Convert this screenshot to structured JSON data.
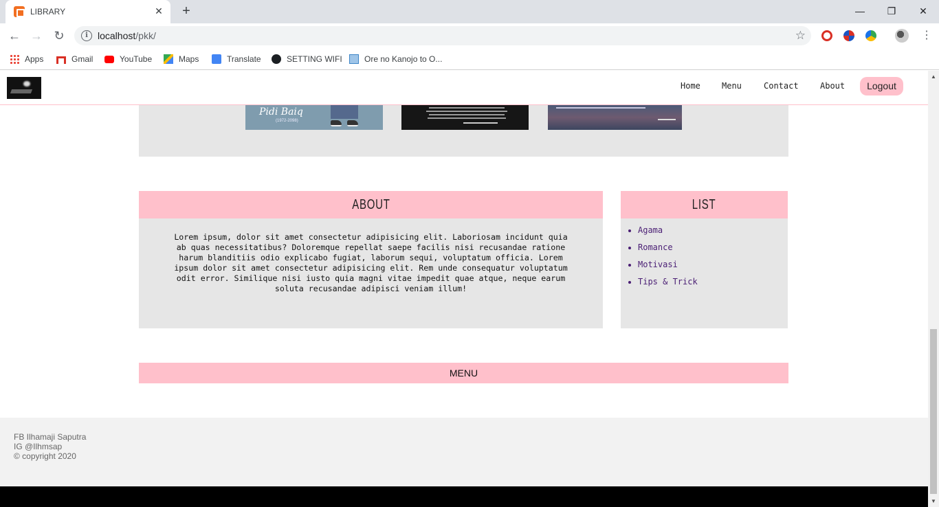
{
  "browser": {
    "tab_title": "LIBRARY",
    "tab_close": "✕",
    "new_tab": "+",
    "url_host": "localhost",
    "url_path": "/pkk/",
    "window_controls": {
      "minimize": "—",
      "restore": "❐",
      "close": "✕"
    },
    "bookmarks": [
      {
        "label": "Apps",
        "icon": "apps-grid-icon"
      },
      {
        "label": "Gmail",
        "icon": "gmail-icon"
      },
      {
        "label": "YouTube",
        "icon": "youtube-icon"
      },
      {
        "label": "Maps",
        "icon": "maps-icon"
      },
      {
        "label": "Translate",
        "icon": "translate-icon"
      },
      {
        "label": "SETTING WIFI",
        "icon": "github-icon"
      },
      {
        "label": "Ore no Kanojo to O...",
        "icon": "bookmark-page-icon"
      }
    ]
  },
  "site": {
    "nav": {
      "links": [
        "Home",
        "Menu",
        "Contact",
        "About"
      ],
      "logout": "Logout"
    },
    "gallery": {
      "thumb1_signature": "Pidi Baiq",
      "thumb1_years": "(1972-2098)"
    },
    "about": {
      "heading": "ABOUT",
      "body": "Lorem ipsum, dolor sit amet consectetur adipisicing elit. Laboriosam incidunt quia ab quas necessitatibus? Doloremque repellat saepe facilis nisi recusandae ratione harum blanditiis odio explicabo fugiat, laborum sequi, voluptatum officia. Lorem ipsum dolor sit amet consectetur adipisicing elit. Rem unde consequatur voluptatum odit error. Similique nisi iusto quia magni vitae impedit quae atque, neque earum soluta recusandae adipisci veniam illum!"
    },
    "list": {
      "heading": "LIST",
      "items": [
        "Agama",
        "Romance",
        "Motivasi",
        "Tips & Trick"
      ]
    },
    "menu_bar": "MENU",
    "footer": {
      "line1": "FB Ilhamaji Saputra",
      "line2": "IG @Ilhmsap",
      "line3": "© copyright 2020"
    }
  },
  "colors": {
    "accent_pink": "#ffc0cb",
    "panel_gray": "#e6e6e6",
    "link_purple": "#4a1e74"
  }
}
